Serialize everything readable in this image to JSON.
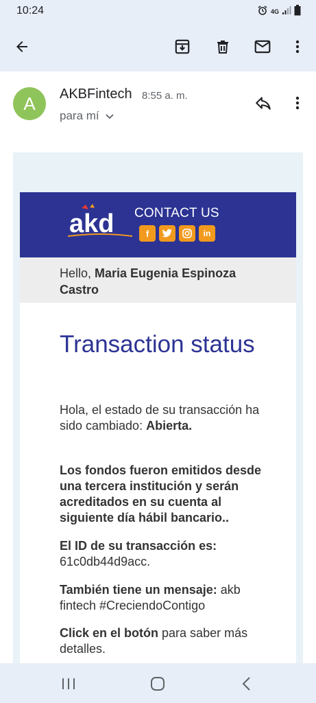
{
  "status_bar": {
    "time": "10:24",
    "network": "4G"
  },
  "toolbar": {
    "back_icon": "arrow-left-icon",
    "archive_icon": "archive-icon",
    "delete_icon": "trash-icon",
    "mail_icon": "mail-icon",
    "more_icon": "more-vert-icon"
  },
  "message": {
    "avatar_letter": "A",
    "sender": "AKBFintech",
    "time": "8:55 a. m.",
    "recipient": "para mí"
  },
  "email": {
    "contact_label": "CONTACT US",
    "greeting_prefix": "Hello, ",
    "greeting_name": "Maria Eugenia Espinoza Castro",
    "title": "Transaction status",
    "p1_text": "Hola, el estado de su transacción ha sido cambiado: ",
    "p1_status": "Abierta.",
    "p2": "Los fondos fueron emitidos desde una tercera institución y serán acreditados en su cuenta al siguiente día hábil bancario..",
    "p3_label": "El ID de su transacción es:",
    "p3_value": "61c0db44d9acc.",
    "p4_label": "También tiene un mensaje:",
    "p4_value": " akb fintech #CreciendoContigo",
    "p5_label": "Click en el botón",
    "p5_value": " para saber más detalles."
  },
  "colors": {
    "header_blue": "#2c3393",
    "accent_orange": "#f29a1e",
    "avatar_green": "#8fc45a",
    "appbar": "#e8eef7"
  }
}
